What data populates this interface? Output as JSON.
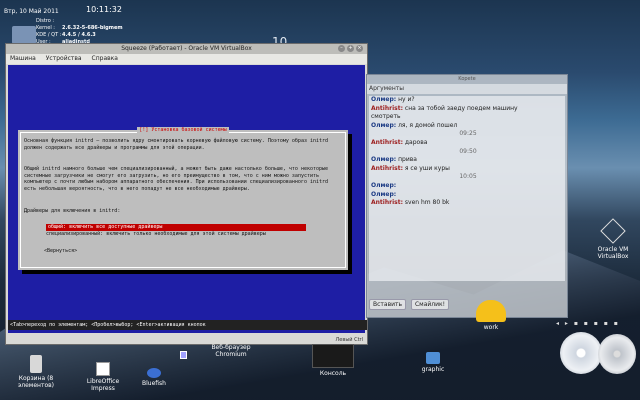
{
  "desktop": {
    "date": "Втр, 10 Май 2011",
    "time": "10:11:32",
    "big_clock": "10",
    "sysinfo": [
      {
        "label": "Distro :",
        "value": ""
      },
      {
        "label": "Kernel :",
        "value": "2.6.32-5-686-bigmem"
      },
      {
        "label": "KDE / QT :",
        "value": "4.4.5 / 4.6.3"
      },
      {
        "label": "User :",
        "value": "aliadinstd"
      }
    ]
  },
  "vbox": {
    "title": "Squeeze (Работает) - Oracle VM VirtualBox",
    "menu": [
      "Машина",
      "Устройства",
      "Справка"
    ],
    "dialog_title": "[!] Установка базовой системы",
    "para1": "Основная функция initrd — позволить ядру смонтировать корневую файловую систему. Поэтому образ initrd должен содержать все драйверы и программы для этой операции.",
    "para2": "Общий initrd намного больше чем специализированный, а может быть даже настолько больше, что некоторые системные загрузчики не смогут его загрузить, но его преимущество в том, что с ним можно запустить компьютер с почти любым набором аппаратного обеспечения. При использовании специализированного initrd есть небольшая вероятность, что в него попадут не все необходимые драйверы.",
    "prompt": "Драйверы для включения в initrd:",
    "option_selected": "общий: включить все доступные драйверы",
    "option2": "специализированный: включить только необходимые для этой системы драйверы",
    "back": "<Вернуться>",
    "statusline": "<Tab>переход по элементам; <Пробел>выбор; <Enter>активация кнопок",
    "host_key": "Левый Ctrl"
  },
  "chat": {
    "title": "Kopete",
    "tab_label": "Аргументы",
    "messages": [
      {
        "nick": "Олмер:",
        "text": "ну и?",
        "type": "o"
      },
      {
        "nick": "Antihrist:",
        "text": "сна за тобой заеду поедем машину",
        "type": "a"
      },
      {
        "nick": "",
        "text": "смотреть",
        "type": "plain"
      },
      {
        "nick": "Олмер:",
        "text": "ля, я домой пошел",
        "type": "o"
      },
      {
        "nick": "",
        "text": "09:25",
        "type": "ts"
      },
      {
        "nick": "Antihrist:",
        "text": "дарова",
        "type": "a"
      },
      {
        "nick": "",
        "text": "09:50",
        "type": "ts"
      },
      {
        "nick": "Олмер:",
        "text": "прива",
        "type": "o"
      },
      {
        "nick": "Antihrist:",
        "text": "я се уши куры",
        "type": "a"
      },
      {
        "nick": "",
        "text": "10:05",
        "type": "ts"
      },
      {
        "nick": "Олмер:",
        "text": "",
        "type": "o"
      },
      {
        "nick": "Олмер:",
        "text": "",
        "type": "o"
      },
      {
        "nick": "Antihrist:",
        "text": "sven hm 80 bk",
        "type": "a"
      }
    ],
    "insert_label": "Вставить",
    "smile_label": "Смайлик!"
  },
  "icons": {
    "trash": "Корзина (8 элементов)",
    "libreoffice": "LibreOffice Impress",
    "bluefish": "Bluefish",
    "chromium": "Веб-браузер Chromium",
    "console": "Консоль",
    "graphic": "graphic",
    "work": "work",
    "virtualbox": "Oracle VM VirtualBox"
  },
  "player": {
    "controls": "◂ ▸ ▪ ▪ ▪ ▪ ▪"
  }
}
